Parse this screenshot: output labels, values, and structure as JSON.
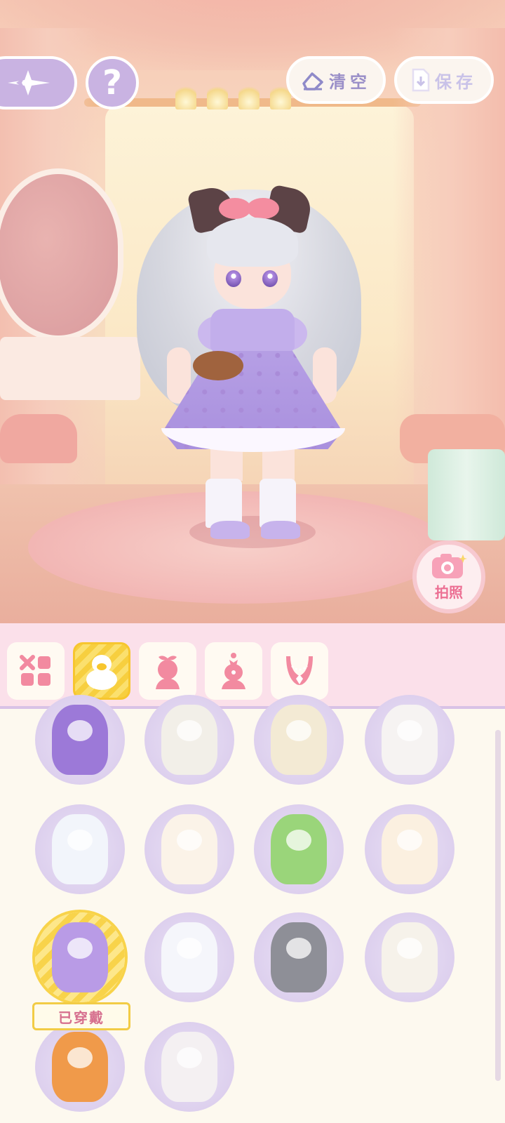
{
  "top_bar": {
    "back_icon": "sparkle-arrow-icon",
    "help_label": "?",
    "clear_label": "清空",
    "clear_icon": "eraser-icon",
    "save_label": "保存",
    "save_icon": "save-file-icon"
  },
  "photo_button": {
    "label": "拍照",
    "icon": "camera-icon"
  },
  "tabs": [
    {
      "name": "all",
      "icon": "grid-icon",
      "active": false
    },
    {
      "name": "costume",
      "icon": "duck-suit-icon",
      "active": true
    },
    {
      "name": "hat",
      "icon": "bow-head-icon",
      "active": false
    },
    {
      "name": "headwear",
      "icon": "head-accessory-icon",
      "active": false
    },
    {
      "name": "necklace",
      "icon": "necklace-icon",
      "active": false
    }
  ],
  "items": [
    {
      "name": "purple-octopus-suit",
      "color": "#9c79d8"
    },
    {
      "name": "mummy-suit",
      "color": "#f2efe8"
    },
    {
      "name": "lion-dance-suit",
      "color": "#f3ead4"
    },
    {
      "name": "magician-bear-suit",
      "color": "#f6f3f2"
    },
    {
      "name": "white-cat-cape",
      "color": "#f2f5fb"
    },
    {
      "name": "calico-cat-suit",
      "color": "#fbf3e8"
    },
    {
      "name": "frog-suit",
      "color": "#9ad57a"
    },
    {
      "name": "unicorn-suit",
      "color": "#fbf0e0"
    },
    {
      "name": "lavender-bear-dress",
      "color": "#b99be6",
      "worn": true
    },
    {
      "name": "white-bear-suit",
      "color": "#f5f6fb"
    },
    {
      "name": "grey-bear-suit",
      "color": "#8e8f97"
    },
    {
      "name": "sheep-gentleman-suit",
      "color": "#f6f2ea"
    },
    {
      "name": "fox-suit",
      "color": "#f09a4a"
    },
    {
      "name": "white-cat-punk-suit",
      "color": "#f4f0f2"
    }
  ],
  "worn_label": "已穿戴",
  "colors": {
    "accent": "#f7c62e",
    "tab_bg": "#fbe0ea",
    "icon_pink": "#f28aa0",
    "button_purple": "#c9b3e2"
  }
}
